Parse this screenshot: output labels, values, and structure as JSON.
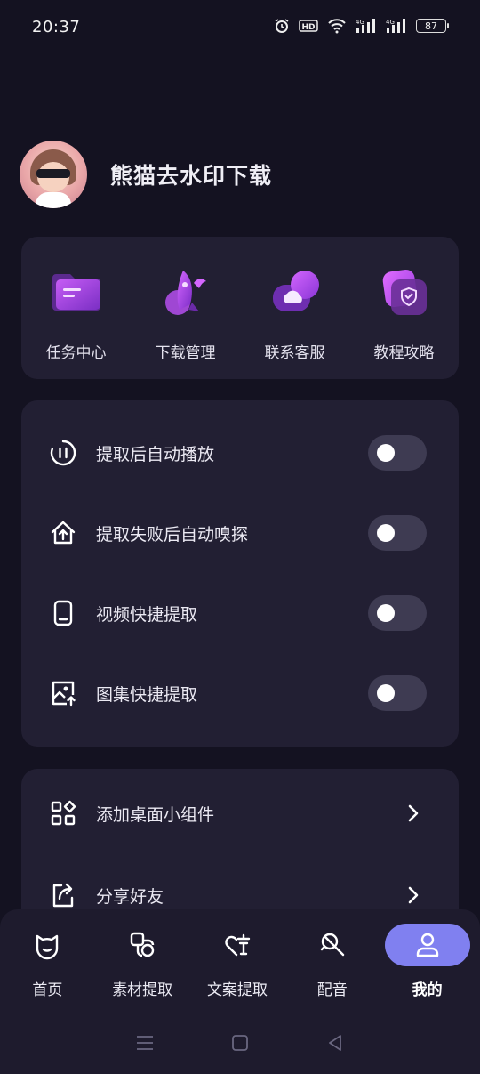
{
  "status_bar": {
    "time": "20:37",
    "battery": "87",
    "icons": [
      "alarm-icon",
      "hd-icon",
      "wifi-icon",
      "signal-4g-icon",
      "signal-4g-icon",
      "battery-icon"
    ]
  },
  "profile": {
    "name": "熊猫去水印下载"
  },
  "quick_actions": [
    {
      "label": "任务中心",
      "icon": "folder-icon"
    },
    {
      "label": "下载管理",
      "icon": "rocket-icon"
    },
    {
      "label": "联系客服",
      "icon": "cloud-chat-icon"
    },
    {
      "label": "教程攻略",
      "icon": "shield-icon"
    }
  ],
  "settings": [
    {
      "label": "提取后自动播放",
      "icon": "pause-circle-icon",
      "enabled": false
    },
    {
      "label": "提取失败后自动嗅探",
      "icon": "upload-home-icon",
      "enabled": false
    },
    {
      "label": "视频快捷提取",
      "icon": "phone-icon",
      "enabled": false
    },
    {
      "label": "图集快捷提取",
      "icon": "image-upload-icon",
      "enabled": false
    }
  ],
  "links": [
    {
      "label": "添加桌面小组件",
      "icon": "widgets-icon"
    },
    {
      "label": "分享好友",
      "icon": "share-icon"
    }
  ],
  "bottom_nav": [
    {
      "label": "首页",
      "icon": "home-icon",
      "active": false
    },
    {
      "label": "素材提取",
      "icon": "material-icon",
      "active": false
    },
    {
      "label": "文案提取",
      "icon": "text-extract-icon",
      "active": false
    },
    {
      "label": "配音",
      "icon": "dubbing-icon",
      "active": false
    },
    {
      "label": "我的",
      "icon": "user-icon",
      "active": true
    }
  ],
  "colors": {
    "background": "#141221",
    "card": "#221f33",
    "accent": "#8080f0",
    "purple": "#b14cf0",
    "switch_off": "#3e3b52"
  }
}
